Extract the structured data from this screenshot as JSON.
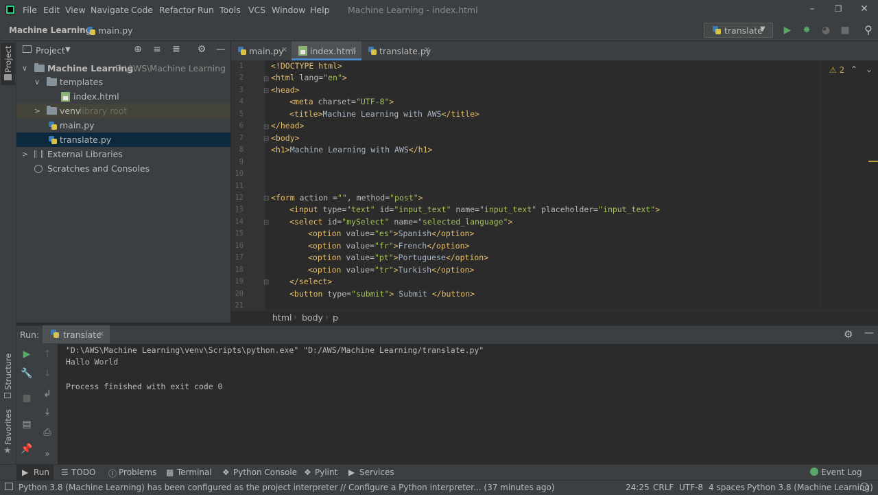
{
  "menu": [
    "File",
    "Edit",
    "View",
    "Navigate",
    "Code",
    "Refactor",
    "Run",
    "Tools",
    "VCS",
    "Window",
    "Help"
  ],
  "window_title": "Machine Learning - index.html",
  "nav": {
    "project": "Machine Learning",
    "file": "main.py"
  },
  "run_config": {
    "label": "translate"
  },
  "side_tools": {
    "project": "Project",
    "structure": "Structure",
    "favorites": "Favorites"
  },
  "project_panel": {
    "title": "Project",
    "tree": {
      "root": "Machine Learning",
      "root_path": "D:\\AWS\\Machine Learning",
      "templates": "templates",
      "index": "index.html",
      "venv": "venv",
      "venv_hint": "library root",
      "main": "main.py",
      "translate": "translate.py",
      "external": "External Libraries",
      "scratches": "Scratches and Consoles"
    }
  },
  "editor": {
    "tabs": [
      "main.py",
      "index.html",
      "translate.py"
    ],
    "active_tab": "index.html",
    "warnings": "2",
    "breadcrumb": [
      "html",
      "body",
      "p"
    ],
    "line_numbers": [
      "1",
      "2",
      "3",
      "4",
      "5",
      "6",
      "7",
      "8",
      "9",
      "10",
      "11",
      "12",
      "13",
      "14",
      "15",
      "16",
      "17",
      "18",
      "19",
      "20",
      "21"
    ],
    "lines": [
      [
        "<!DOCTYPE html>"
      ],
      [
        "<html ",
        "lang=",
        "\"en\"",
        ">"
      ],
      [
        "<head>"
      ],
      [
        "<meta ",
        "charset=",
        "\"UTF-8\"",
        ">"
      ],
      [
        "<title>",
        "Machine Learning with AWS",
        "</title>"
      ],
      [
        "</head>"
      ],
      [
        "<body>"
      ],
      [
        "<h1>",
        "Machine Learning with AWS",
        "</h1>"
      ],
      [],
      [],
      [],
      [
        "<form ",
        "action =",
        "\"\"",
        ", ",
        "method=",
        "\"post\"",
        ">"
      ],
      [
        "<input ",
        "type=",
        "\"text\"",
        " id=",
        "\"input_text\"",
        " name=",
        "\"input_text\"",
        " placeholder=",
        "\"input_text\"",
        ">"
      ],
      [
        "<select ",
        "id=",
        "\"mySelect\"",
        " name=",
        "\"selected_language\"",
        ">"
      ],
      [
        "<option ",
        "value=",
        "\"es\"",
        ">",
        "Spanish",
        "</option>"
      ],
      [
        "<option ",
        "value=",
        "\"fr\"",
        ">",
        "French",
        "</option>"
      ],
      [
        "<option ",
        "value=",
        "\"pt\"",
        ">",
        "Portuguese",
        "</option>"
      ],
      [
        "<option ",
        "value=",
        "\"tr\"",
        ">",
        "Turkish",
        "</option>"
      ],
      [
        "</select>"
      ],
      [
        "<button ",
        "type=",
        "\"submit\"",
        ">",
        " Submit ",
        "</button>"
      ],
      []
    ]
  },
  "run_panel": {
    "label": "Run:",
    "tab": "translate",
    "console": [
      "\"D:\\AWS\\Machine Learning\\venv\\Scripts\\python.exe\" \"D:/AWS/Machine Learning/translate.py\"",
      "Hallo World",
      "",
      "Process finished with exit code 0"
    ]
  },
  "bottom_tools": [
    "Run",
    "TODO",
    "Problems",
    "Terminal",
    "Python Console",
    "Pylint",
    "Services"
  ],
  "event_log": "Event Log",
  "status": {
    "message": "Python 3.8 (Machine Learning) has been configured as the project interpreter // Configure a Python interpreter... (37 minutes ago)",
    "position": "24:25",
    "line_sep": "CRLF",
    "encoding": "UTF-8",
    "indent": "4 spaces",
    "interpreter": "Python 3.8 (Machine Learning)"
  }
}
